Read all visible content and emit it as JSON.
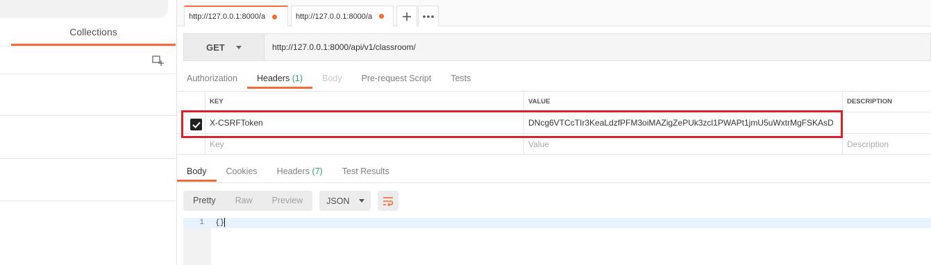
{
  "sidebar": {
    "tab_label": "Collections"
  },
  "tabs": [
    {
      "label": "http://127.0.0.1:8000/a"
    },
    {
      "label": "http://127.0.0.1:8000/a"
    }
  ],
  "request": {
    "method": "GET",
    "url": "http://127.0.0.1:8000/api/v1/classroom/"
  },
  "request_tabs": {
    "authorization": "Authorization",
    "headers": "Headers",
    "headers_count": "(1)",
    "body": "Body",
    "prerequest": "Pre-request Script",
    "tests": "Tests"
  },
  "headers_table": {
    "col_key": "KEY",
    "col_value": "VALUE",
    "col_description": "DESCRIPTION",
    "row": {
      "key": "X-CSRFToken",
      "value": "DNcg6VTCcTIr3KeaLdzfPFM3oiMAZigZePUk3zcl1PWAPt1jmU5uWxtrMgFSKAsD",
      "checked": true
    },
    "placeholder_key": "Key",
    "placeholder_value": "Value",
    "placeholder_description": "Description"
  },
  "response_tabs": {
    "body": "Body",
    "cookies": "Cookies",
    "headers": "Headers",
    "headers_count": "(7)",
    "test_results": "Test Results"
  },
  "response_toolbar": {
    "pretty": "Pretty",
    "raw": "Raw",
    "preview": "Preview",
    "format": "JSON"
  },
  "editor": {
    "line_number": "1",
    "content": "{}"
  },
  "colors": {
    "accent": "#f26b3a",
    "highlight_border": "#d9212c",
    "count_green": "#35a064"
  }
}
